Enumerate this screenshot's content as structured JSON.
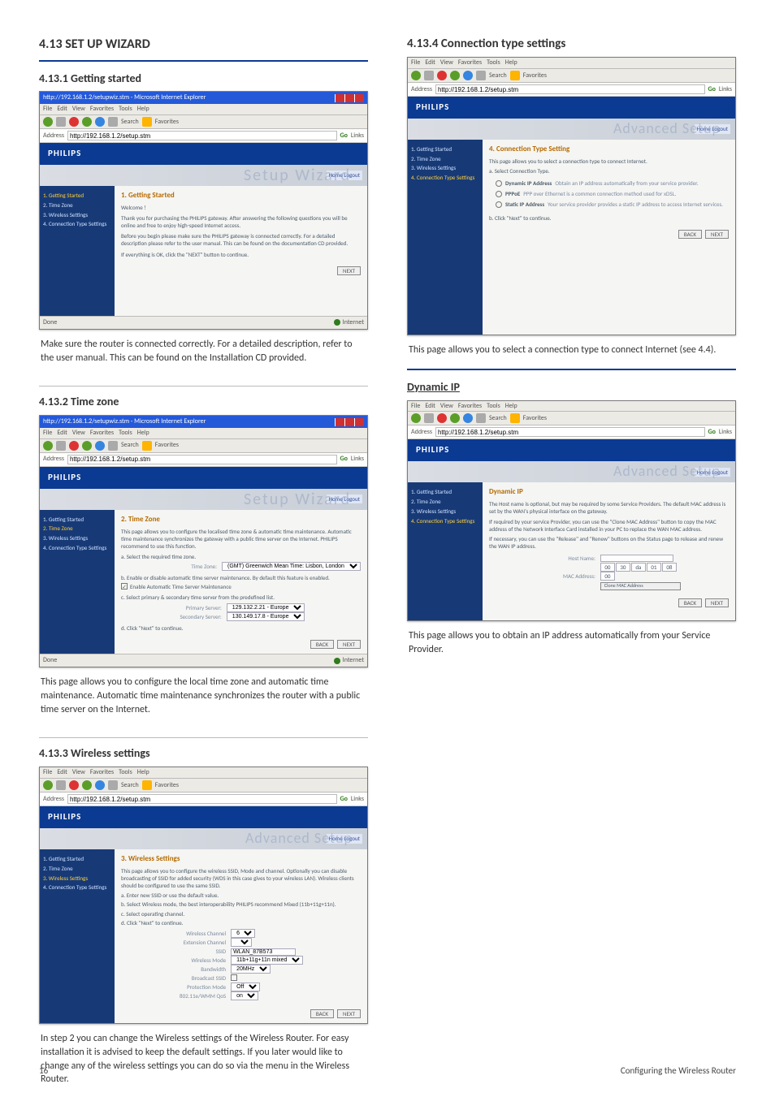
{
  "page_number": "16",
  "footer_right": "Configuring the Wireless Router",
  "left": {
    "h413": "4.13  SET UP WIZARD",
    "h4131": "4.13.1  Getting started",
    "h4132": "4.13.2  Time zone",
    "h4133": "4.13.3  Wireless settings",
    "para1": "Make sure the router is connected correctly. For a detailed description, refer to the user manual. This can be found on the Installation CD provided.",
    "para2": "This page allows you to configure the local time zone and automatic time maintenance. Automatic time maintenance synchronizes the router with a public time server on the Internet.",
    "para3": "In step 2 you can change the Wireless settings of the Wireless Router. For easy installation it is advised to keep the default settings. If you later would like to change any of the wireless settings you can do so via the menu in the Wireless Router."
  },
  "right": {
    "h4134": "4.13.4  Connection type settings",
    "hdyn": "Dynamic IP",
    "para1": "This page allows you to select a connection type to connect Internet (see 4.4).",
    "para2": "This page allows you to obtain an IP address automatically from your Service Provider."
  },
  "browser": {
    "title_ie": "http://192.168.1.2/setupwiz.stm - Microsoft Internet Explorer",
    "menus": [
      "File",
      "Edit",
      "View",
      "Favorites",
      "Tools",
      "Help"
    ],
    "tb_search": "Search",
    "tb_fav": "Favorites",
    "addr_label": "Address",
    "addr_val": "http://192.168.1.2/setup.stm",
    "go": "Go",
    "links": "Links",
    "brand": "PHILIPS",
    "setup_ghost": "Setup Wizard",
    "adv_ghost": "Advanced Setup",
    "home_tag": "Home  Logout",
    "done": "Done",
    "internet": "Internet",
    "btn_back": "BACK",
    "btn_next": "NEXT",
    "sidebar": {
      "s1": "1. Getting Started",
      "s2": "2. Time Zone",
      "s3": "3. Wireless Settings",
      "s4": "4. Connection Type Settings"
    }
  },
  "mock1": {
    "title": "1. Getting Started",
    "l1": "Welcome !",
    "l2": "Thank you for purchasing the PHILIPS gateway. After answering the following questions you will be online and free to enjoy high-speed Internet access.",
    "l3": "Before you begin please make sure the PHILIPS gateway is connected correctly. For a detailed description please refer to the user manual. This can be found on the documentation CD provided.",
    "l4": "If everything is OK, click the \"NEXT\" button to continue."
  },
  "mock2": {
    "title": "2. Time Zone",
    "intro": "This page allows you to configure the localised time zone & automatic time maintenance. Automatic time maintenance synchronizes the gateway with a public time server on the Internet. PHILIPS recommend to use this function.",
    "a_label": "a. Select the required time zone.",
    "tz_row": "Time Zone:",
    "tz_val": "(GMT) Greenwich Mean Time: Lisbon, London",
    "b_label": "b. Enable or disable automatic time server maintenance. By default this feature is enabled.",
    "b_chk": "Enable Automatic Time Server Maintenance",
    "c_label": "c. Select primary & secondary time server from the predefined list.",
    "ps_row": "Primary Server:",
    "ps_val": "129.132.2.21 - Europe",
    "ss_row": "Secondary Server:",
    "ss_val": "130.149.17.8 - Europe",
    "d_label": "d. Click \"Next\" to continue."
  },
  "mock3": {
    "title": "3. Wireless Settings",
    "intro": "This page allows you to configure the wireless SSID, Mode and channel. Optionally you can disable broadcasting of SSID for added security (WDS in this case gives to your wireless LAN). Wireless clients should be configured to use the same SSID.",
    "a": "a. Enter new SSID or use the default value.",
    "a2": "b. Select Wireless mode, the best interoperability PHILIPS recommend Mixed (11b+11g+11n).",
    "c": "c. Select operating channel.",
    "d": "d. Click \"Next\" to continue.",
    "rows": {
      "wch": "Wireless Channel",
      "wch_v": "6",
      "ech": "Extension Channel",
      "ech_v": "",
      "ssid": "SSID",
      "ssid_v": "WLAN_87B573",
      "mode": "Wireless Mode",
      "mode_v": "11b+11g+11n mixed",
      "bw": "Bandwidth",
      "bw_v": "20MHz",
      "bc": "Broadcast SSID",
      "bc_v": "",
      "pm": "Protection Mode",
      "pm_v": "Off",
      "wmm": "802.11e/WMM QoS",
      "wmm_v": "on"
    }
  },
  "mock4": {
    "title": "4. Connection Type Setting",
    "intro": "This page allows you to select a connection type to connect Internet.",
    "a": "a. Select Connection Type.",
    "r1t": "Dynamic IP Address",
    "r1d": "Obtain an IP address automatically from your service provider.",
    "r2t": "PPPoE",
    "r2d": "PPP over Ethernet is a common connection method used for xDSL.",
    "r3t": "Static IP Address",
    "r3d": "Your service provider provides a static IP address to access Internet services.",
    "b": "b. Click \"Next\" to continue."
  },
  "mock5": {
    "title": "Dynamic IP",
    "l1": "The Host name is optional, but may be required by some Service Providers. The default MAC address is set by the WAN's physical interface on the gateway.",
    "l2": "If required by your service Provider, you can use the \"Clone MAC Address\" button to copy the MAC address of the Network Interface Card installed in your PC to replace the WAN MAC address.",
    "l3": "If necessary, you can use the \"Release\" and \"Renew\" buttons on the Status page to release and renew the WAN IP address.",
    "hn": "Host Name:",
    "mac": "MAC Address:",
    "mac_v": [
      "00",
      "30",
      "da",
      "01",
      "08",
      "00"
    ],
    "clone": "Clone MAC Address"
  }
}
